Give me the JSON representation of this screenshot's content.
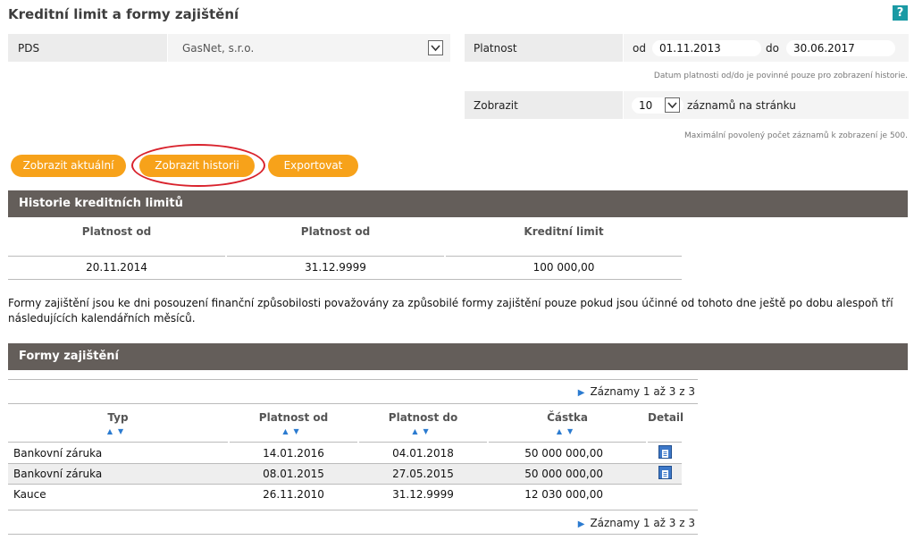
{
  "page": {
    "title": "Kreditní limit a formy zajištění",
    "help_label": "?"
  },
  "filters": {
    "pds_label": "PDS",
    "pds_value": "GasNet, s.r.o.",
    "validity_label": "Platnost",
    "from_label": "od",
    "from_value": "01.11.2013",
    "to_label": "do",
    "to_value": "30.06.2017",
    "validity_hint": "Datum platnosti od/do je povinné pouze pro zobrazení historie.",
    "show_label": "Zobrazit",
    "show_value": "10",
    "show_suffix": "záznamů na stránku",
    "show_hint": "Maximální povolený počet záznamů k zobrazení je 500."
  },
  "buttons": {
    "current": "Zobrazit aktuální",
    "history": "Zobrazit historii",
    "export": "Exportovat"
  },
  "credit_history": {
    "title": "Historie kreditních limitů",
    "columns": [
      "Platnost od",
      "Platnost od",
      "Kreditní limit"
    ],
    "rows": [
      [
        "20.11.2014",
        "31.12.9999",
        "100 000,00"
      ]
    ]
  },
  "note": "Formy zajištění jsou ke dni posouzení finanční způsobilosti považovány za způsobilé formy zajištění pouze pokud jsou účinné od tohoto dne ještě po dobu alespoň tří následujících kalendářních měsíců.",
  "guarantees": {
    "title": "Formy zajištění",
    "pager": "Záznamy 1 až 3 z 3",
    "columns": [
      "Typ",
      "Platnost od",
      "Platnost do",
      "Částka",
      "Detail"
    ],
    "rows": [
      [
        "Bankovní záruka",
        "14.01.2016",
        "04.01.2018",
        "50 000 000,00"
      ],
      [
        "Bankovní záruka",
        "08.01.2015",
        "27.05.2015",
        "50 000 000,00"
      ],
      [
        "Kauce",
        "26.11.2010",
        "31.12.9999",
        "12 030 000,00"
      ]
    ],
    "sort_glyph": "▲▼"
  },
  "colors": {
    "accent": "#f7a21a",
    "section_header": "#645e5a",
    "highlight": "#d9232d",
    "help": "#1a9aa4"
  }
}
